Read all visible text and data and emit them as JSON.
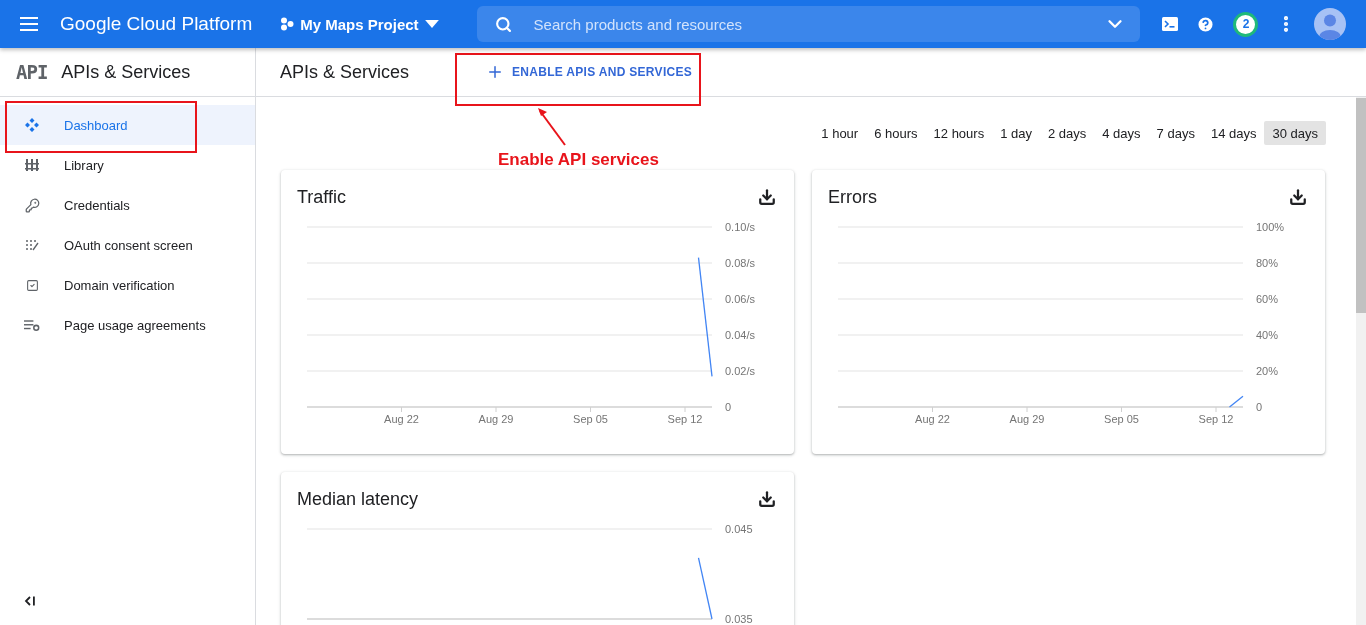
{
  "topbar": {
    "product": "Google Cloud Platform",
    "project": "My Maps Project",
    "search": {
      "placeholder": "Search products and resources"
    },
    "notification_count": "2"
  },
  "sidebar": {
    "logo": "API",
    "title": "APIs & Services",
    "items": [
      {
        "label": "Dashboard",
        "selected": true
      },
      {
        "label": "Library",
        "selected": false
      },
      {
        "label": "Credentials",
        "selected": false
      },
      {
        "label": "OAuth consent screen",
        "selected": false
      },
      {
        "label": "Domain verification",
        "selected": false
      },
      {
        "label": "Page usage agreements",
        "selected": false
      }
    ]
  },
  "header": {
    "title": "APIs & Services",
    "action": "ENABLE APIS AND SERVICES"
  },
  "annotation": {
    "text": "Enable API services"
  },
  "time_ranges": [
    {
      "label": "1 hour",
      "selected": false
    },
    {
      "label": "6 hours",
      "selected": false
    },
    {
      "label": "12 hours",
      "selected": false
    },
    {
      "label": "1 day",
      "selected": false
    },
    {
      "label": "2 days",
      "selected": false
    },
    {
      "label": "4 days",
      "selected": false
    },
    {
      "label": "7 days",
      "selected": false
    },
    {
      "label": "14 days",
      "selected": false
    },
    {
      "label": "30 days",
      "selected": true
    }
  ],
  "cards": [
    {
      "title": "Traffic",
      "chart_data": {
        "type": "line",
        "grid": true,
        "ylim": [
          0,
          0.1
        ],
        "categories": [
          null,
          null,
          null,
          null,
          null,
          null,
          null,
          "Aug 22",
          null,
          null,
          null,
          null,
          null,
          null,
          "Aug 29",
          null,
          null,
          null,
          null,
          null,
          null,
          "Sep 05",
          null,
          null,
          null,
          null,
          null,
          null,
          "Sep 12",
          null,
          null
        ],
        "yticks": [
          {
            "value": 0,
            "label": "0"
          },
          {
            "value": 0.02,
            "label": "0.02/s"
          },
          {
            "value": 0.04,
            "label": "0.04/s"
          },
          {
            "value": 0.06,
            "label": "0.06/s"
          },
          {
            "value": 0.08,
            "label": "0.08/s"
          },
          {
            "value": 0.1,
            "label": "0.10/s"
          }
        ],
        "series": [
          {
            "color": "#4285f4",
            "values": [
              null,
              null,
              null,
              null,
              null,
              null,
              null,
              null,
              null,
              null,
              null,
              null,
              null,
              null,
              null,
              null,
              null,
              null,
              null,
              null,
              null,
              null,
              null,
              null,
              null,
              null,
              null,
              null,
              null,
              0.083,
              0.017
            ]
          }
        ]
      }
    },
    {
      "title": "Errors",
      "chart_data": {
        "type": "line",
        "grid": true,
        "ylim": [
          0,
          100
        ],
        "categories": [
          null,
          null,
          null,
          null,
          null,
          null,
          null,
          "Aug 22",
          null,
          null,
          null,
          null,
          null,
          null,
          "Aug 29",
          null,
          null,
          null,
          null,
          null,
          null,
          "Sep 05",
          null,
          null,
          null,
          null,
          null,
          null,
          "Sep 12",
          null,
          null
        ],
        "yticks": [
          {
            "value": 0,
            "label": "0"
          },
          {
            "value": 20,
            "label": "20%"
          },
          {
            "value": 40,
            "label": "40%"
          },
          {
            "value": 60,
            "label": "60%"
          },
          {
            "value": 80,
            "label": "80%"
          },
          {
            "value": 100,
            "label": "100%"
          }
        ],
        "series": [
          {
            "color": "#4285f4",
            "values": [
              null,
              null,
              null,
              null,
              null,
              null,
              null,
              null,
              null,
              null,
              null,
              null,
              null,
              null,
              null,
              null,
              null,
              null,
              null,
              null,
              null,
              null,
              null,
              null,
              null,
              null,
              null,
              null,
              null,
              0,
              6
            ]
          }
        ]
      }
    },
    {
      "title": "Median latency",
      "chart_data": {
        "type": "line",
        "ylim": [
          0.035,
          0.045
        ],
        "categories": [
          null,
          null,
          null,
          null,
          null,
          null,
          null,
          null,
          null,
          null,
          null,
          null,
          null,
          null,
          null,
          null,
          null,
          null,
          null,
          null,
          null,
          null,
          null,
          null,
          null,
          null,
          null,
          null,
          null,
          null,
          null
        ],
        "yticks": [
          {
            "value": 0.035,
            "label": "0.035"
          },
          {
            "value": 0.045,
            "label": "0.045"
          }
        ],
        "series": [
          {
            "color": "#4285f4",
            "values": [
              null,
              null,
              null,
              null,
              null,
              null,
              null,
              null,
              null,
              null,
              null,
              null,
              null,
              null,
              null,
              null,
              null,
              null,
              null,
              null,
              null,
              null,
              null,
              null,
              null,
              null,
              null,
              null,
              null,
              0.0418,
              0.035
            ]
          }
        ]
      }
    }
  ]
}
